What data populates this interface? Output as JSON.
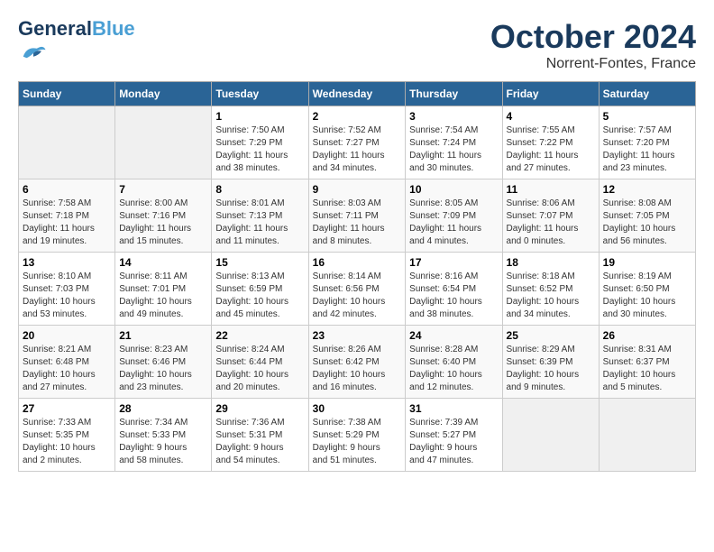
{
  "header": {
    "logo_line1": "General",
    "logo_line2": "Blue",
    "month": "October 2024",
    "location": "Norrent-Fontes, France"
  },
  "weekdays": [
    "Sunday",
    "Monday",
    "Tuesday",
    "Wednesday",
    "Thursday",
    "Friday",
    "Saturday"
  ],
  "weeks": [
    [
      {
        "day": "",
        "info": ""
      },
      {
        "day": "",
        "info": ""
      },
      {
        "day": "1",
        "info": "Sunrise: 7:50 AM\nSunset: 7:29 PM\nDaylight: 11 hours\nand 38 minutes."
      },
      {
        "day": "2",
        "info": "Sunrise: 7:52 AM\nSunset: 7:27 PM\nDaylight: 11 hours\nand 34 minutes."
      },
      {
        "day": "3",
        "info": "Sunrise: 7:54 AM\nSunset: 7:24 PM\nDaylight: 11 hours\nand 30 minutes."
      },
      {
        "day": "4",
        "info": "Sunrise: 7:55 AM\nSunset: 7:22 PM\nDaylight: 11 hours\nand 27 minutes."
      },
      {
        "day": "5",
        "info": "Sunrise: 7:57 AM\nSunset: 7:20 PM\nDaylight: 11 hours\nand 23 minutes."
      }
    ],
    [
      {
        "day": "6",
        "info": "Sunrise: 7:58 AM\nSunset: 7:18 PM\nDaylight: 11 hours\nand 19 minutes."
      },
      {
        "day": "7",
        "info": "Sunrise: 8:00 AM\nSunset: 7:16 PM\nDaylight: 11 hours\nand 15 minutes."
      },
      {
        "day": "8",
        "info": "Sunrise: 8:01 AM\nSunset: 7:13 PM\nDaylight: 11 hours\nand 11 minutes."
      },
      {
        "day": "9",
        "info": "Sunrise: 8:03 AM\nSunset: 7:11 PM\nDaylight: 11 hours\nand 8 minutes."
      },
      {
        "day": "10",
        "info": "Sunrise: 8:05 AM\nSunset: 7:09 PM\nDaylight: 11 hours\nand 4 minutes."
      },
      {
        "day": "11",
        "info": "Sunrise: 8:06 AM\nSunset: 7:07 PM\nDaylight: 11 hours\nand 0 minutes."
      },
      {
        "day": "12",
        "info": "Sunrise: 8:08 AM\nSunset: 7:05 PM\nDaylight: 10 hours\nand 56 minutes."
      }
    ],
    [
      {
        "day": "13",
        "info": "Sunrise: 8:10 AM\nSunset: 7:03 PM\nDaylight: 10 hours\nand 53 minutes."
      },
      {
        "day": "14",
        "info": "Sunrise: 8:11 AM\nSunset: 7:01 PM\nDaylight: 10 hours\nand 49 minutes."
      },
      {
        "day": "15",
        "info": "Sunrise: 8:13 AM\nSunset: 6:59 PM\nDaylight: 10 hours\nand 45 minutes."
      },
      {
        "day": "16",
        "info": "Sunrise: 8:14 AM\nSunset: 6:56 PM\nDaylight: 10 hours\nand 42 minutes."
      },
      {
        "day": "17",
        "info": "Sunrise: 8:16 AM\nSunset: 6:54 PM\nDaylight: 10 hours\nand 38 minutes."
      },
      {
        "day": "18",
        "info": "Sunrise: 8:18 AM\nSunset: 6:52 PM\nDaylight: 10 hours\nand 34 minutes."
      },
      {
        "day": "19",
        "info": "Sunrise: 8:19 AM\nSunset: 6:50 PM\nDaylight: 10 hours\nand 30 minutes."
      }
    ],
    [
      {
        "day": "20",
        "info": "Sunrise: 8:21 AM\nSunset: 6:48 PM\nDaylight: 10 hours\nand 27 minutes."
      },
      {
        "day": "21",
        "info": "Sunrise: 8:23 AM\nSunset: 6:46 PM\nDaylight: 10 hours\nand 23 minutes."
      },
      {
        "day": "22",
        "info": "Sunrise: 8:24 AM\nSunset: 6:44 PM\nDaylight: 10 hours\nand 20 minutes."
      },
      {
        "day": "23",
        "info": "Sunrise: 8:26 AM\nSunset: 6:42 PM\nDaylight: 10 hours\nand 16 minutes."
      },
      {
        "day": "24",
        "info": "Sunrise: 8:28 AM\nSunset: 6:40 PM\nDaylight: 10 hours\nand 12 minutes."
      },
      {
        "day": "25",
        "info": "Sunrise: 8:29 AM\nSunset: 6:39 PM\nDaylight: 10 hours\nand 9 minutes."
      },
      {
        "day": "26",
        "info": "Sunrise: 8:31 AM\nSunset: 6:37 PM\nDaylight: 10 hours\nand 5 minutes."
      }
    ],
    [
      {
        "day": "27",
        "info": "Sunrise: 7:33 AM\nSunset: 5:35 PM\nDaylight: 10 hours\nand 2 minutes."
      },
      {
        "day": "28",
        "info": "Sunrise: 7:34 AM\nSunset: 5:33 PM\nDaylight: 9 hours\nand 58 minutes."
      },
      {
        "day": "29",
        "info": "Sunrise: 7:36 AM\nSunset: 5:31 PM\nDaylight: 9 hours\nand 54 minutes."
      },
      {
        "day": "30",
        "info": "Sunrise: 7:38 AM\nSunset: 5:29 PM\nDaylight: 9 hours\nand 51 minutes."
      },
      {
        "day": "31",
        "info": "Sunrise: 7:39 AM\nSunset: 5:27 PM\nDaylight: 9 hours\nand 47 minutes."
      },
      {
        "day": "",
        "info": ""
      },
      {
        "day": "",
        "info": ""
      }
    ]
  ]
}
